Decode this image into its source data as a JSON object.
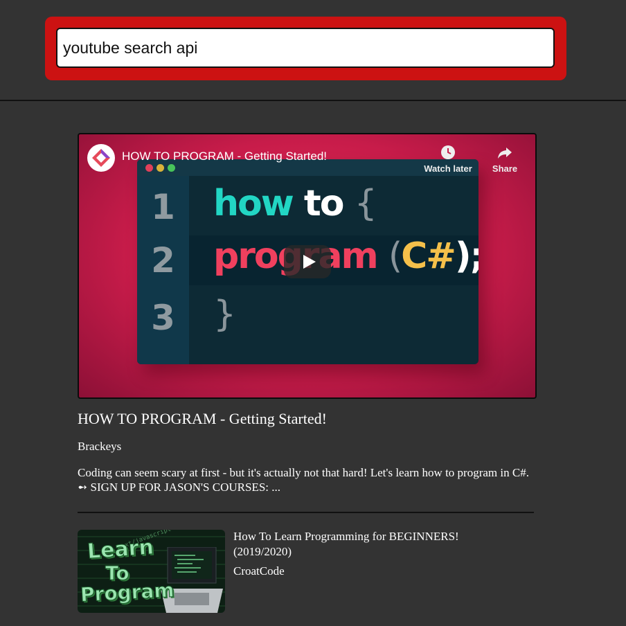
{
  "search": {
    "value": "youtube search api"
  },
  "featured": {
    "player_title": "HOW TO PROGRAM - Getting Started!",
    "watch_later_label": "Watch later",
    "share_label": "Share",
    "thumbnail": {
      "line_numbers": [
        "1",
        "2",
        "3"
      ],
      "line1": {
        "word1": "how",
        "word2": "to",
        "brace": "{"
      },
      "line2": {
        "word": "program",
        "open": "(",
        "lang": "C#",
        "close": ");"
      },
      "line3": {
        "brace": "}"
      }
    },
    "title": "HOW TO PROGRAM - Getting Started!",
    "channel": "Brackeys",
    "description": "Coding can seem scary at first - but it's actually not that hard! Let's learn how to program in C#. ➻ SIGN UP FOR JASON'S COURSES: ..."
  },
  "results": [
    {
      "title": "How To Learn Programming for BEGINNERS! (2019/2020)",
      "channel": "CroatCode",
      "thumbnail_text": [
        "Learn",
        "To",
        "Program"
      ],
      "thumbnail_code_text": "text/javascript"
    }
  ],
  "colors": {
    "background": "#333333",
    "search_frame": "#cc1212",
    "thumbnail_bg": "#d21f4d",
    "code_cyan": "#22d6c4",
    "code_red": "#f0405e",
    "code_yellow": "#f5c04a"
  },
  "icons": [
    "channel-logo-icon",
    "clock-icon",
    "share-icon",
    "play-icon"
  ]
}
